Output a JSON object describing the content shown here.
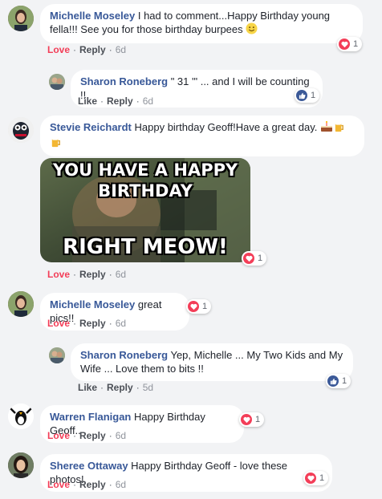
{
  "comments": [
    {
      "author": "Michelle Moseley",
      "text": "I had to comment...Happy Birthday young fella!!! See you for those birthday burpees",
      "actions": {
        "love": "Love",
        "reply": "Reply",
        "time": "6d"
      },
      "reaction": {
        "type": "heart",
        "count": "1"
      },
      "replies": [
        {
          "author": "Sharon Roneberg",
          "text": "\" 31 '\" ... and I will be counting !!",
          "actions": {
            "like": "Like",
            "reply": "Reply",
            "time": "6d"
          },
          "reaction": {
            "type": "like",
            "count": "1"
          }
        }
      ]
    },
    {
      "author": "Stevie Reichardt",
      "text": "Happy birthday Geoff!Have a great day.",
      "meme": {
        "line1": "YOU HAVE A HAPPY",
        "line2": "BIRTHDAY",
        "line3": "RIGHT MEOW!"
      },
      "actions": {
        "love": "Love",
        "reply": "Reply",
        "time": "6d"
      },
      "reaction": {
        "type": "heart",
        "count": "1"
      }
    },
    {
      "author": "Michelle Moseley",
      "text": "great pics!!",
      "actions": {
        "love": "Love",
        "reply": "Reply",
        "time": "6d"
      },
      "reaction": {
        "type": "heart",
        "count": "1"
      },
      "replies": [
        {
          "author": "Sharon Roneberg",
          "text": "Yep, Michelle ... My Two Kids and My Wife ... Love them to bits !!",
          "actions": {
            "like": "Like",
            "reply": "Reply",
            "time": "5d"
          },
          "reaction": {
            "type": "like",
            "count": "1"
          }
        }
      ]
    },
    {
      "author": "Warren Flanigan",
      "text": "Happy Birthday Geoff..",
      "actions": {
        "love": "Love",
        "reply": "Reply",
        "time": "6d"
      },
      "reaction": {
        "type": "heart",
        "count": "1"
      }
    },
    {
      "author": "Sheree Ottaway",
      "text": "Happy Birthday Geoff - love these photos!",
      "actions": {
        "love": "Love",
        "reply": "Reply",
        "time": "6d"
      },
      "reaction": {
        "type": "heart",
        "count": "1"
      }
    }
  ],
  "colors": {
    "author": "#385898",
    "love": "#f33e58",
    "like": "#3b5998",
    "background": "#f2f3f5"
  }
}
